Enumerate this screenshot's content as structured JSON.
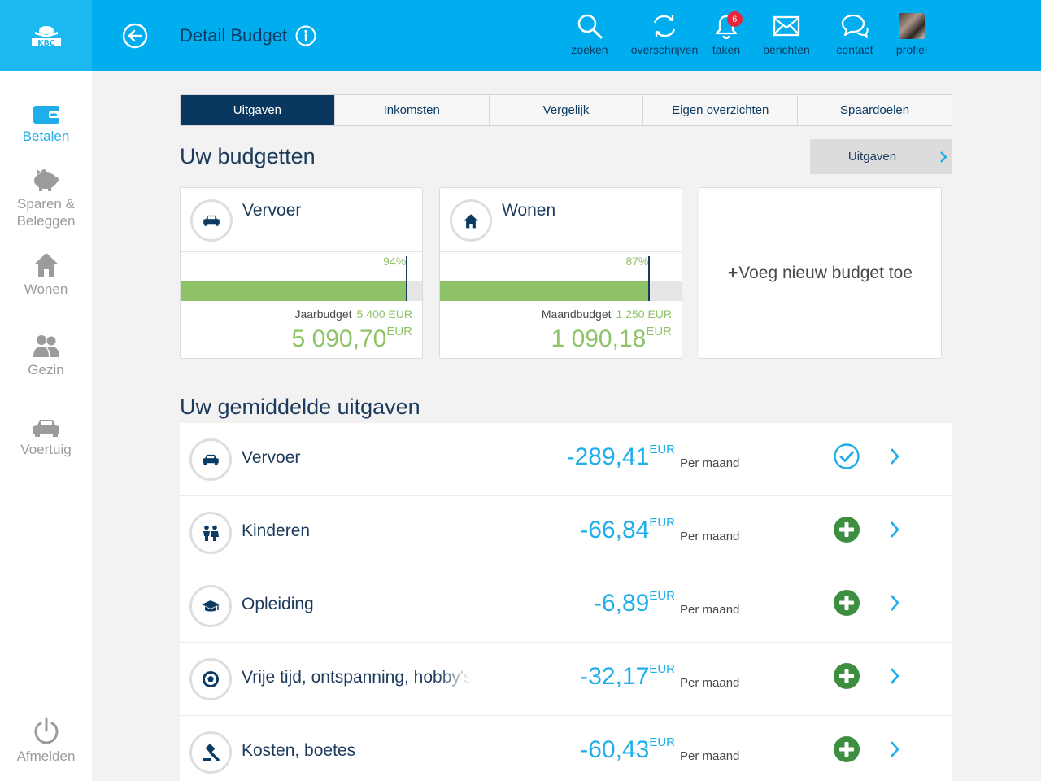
{
  "header": {
    "title": "Detail Budget",
    "nav": [
      {
        "label": "zoeken",
        "icon": "search-icon"
      },
      {
        "label": "overschrijven",
        "icon": "transfer-icon"
      },
      {
        "label": "taken",
        "icon": "bell-icon",
        "badge": "6"
      },
      {
        "label": "berichten",
        "icon": "envelope-icon"
      },
      {
        "label": "contact",
        "icon": "chat-icon"
      },
      {
        "label": "profiel",
        "icon": "avatar"
      }
    ]
  },
  "sidebar": {
    "items": [
      {
        "label": "Betalen",
        "icon": "wallet-icon",
        "active": true
      },
      {
        "label": "Sparen &\nBeleggen",
        "icon": "piggy-bank-icon"
      },
      {
        "label": "Wonen",
        "icon": "house-icon"
      },
      {
        "label": "Gezin",
        "icon": "people-icon"
      },
      {
        "label": "Voertuig",
        "icon": "car-icon"
      }
    ],
    "logout": "Afmelden"
  },
  "tabs": [
    "Uitgaven",
    "Inkomsten",
    "Vergelijk",
    "Eigen overzichten",
    "Spaardoelen"
  ],
  "budgets": {
    "title": "Uw budgetten",
    "filter": "Uitgaven",
    "cards": [
      {
        "name": "Vervoer",
        "icon": "car-icon",
        "percent": 94,
        "percent_label": "94%",
        "budget_label": "Jaarbudget",
        "budget_value": "5 400 EUR",
        "amount": "5 090,70",
        "currency": "EUR"
      },
      {
        "name": "Wonen",
        "icon": "house-icon",
        "percent": 87,
        "percent_label": "87%",
        "budget_label": "Maandbudget",
        "budget_value": "1 250 EUR",
        "amount": "1 090,18",
        "currency": "EUR"
      }
    ],
    "add_label": "Voeg nieuw budget toe"
  },
  "expenses": {
    "title": "Uw gemiddelde uitgaven",
    "rows": [
      {
        "name": "Vervoer",
        "icon": "car-icon",
        "amount": "-289,41",
        "currency": "EUR",
        "period": "Per maand",
        "status": "checked"
      },
      {
        "name": "Kinderen",
        "icon": "children-icon",
        "amount": "-66,84",
        "currency": "EUR",
        "period": "Per maand",
        "status": "add"
      },
      {
        "name": "Opleiding",
        "icon": "graduation-cap-icon",
        "amount": "-6,89",
        "currency": "EUR",
        "period": "Per maand",
        "status": "add"
      },
      {
        "name": "Vrije tijd, ontspanning, hobby's",
        "icon": "soccer-ball-icon",
        "amount": "-32,17",
        "currency": "EUR",
        "period": "Per maand",
        "status": "add"
      },
      {
        "name": "Kosten, boetes",
        "icon": "gavel-icon",
        "amount": "-60,43",
        "currency": "EUR",
        "period": "Per maand",
        "status": "add"
      }
    ]
  },
  "colors": {
    "topbar": "#00aeef",
    "navy": "#0a3760",
    "green": "#8fc367",
    "blue": "#1faee9",
    "add_green": "#3e8e41"
  }
}
